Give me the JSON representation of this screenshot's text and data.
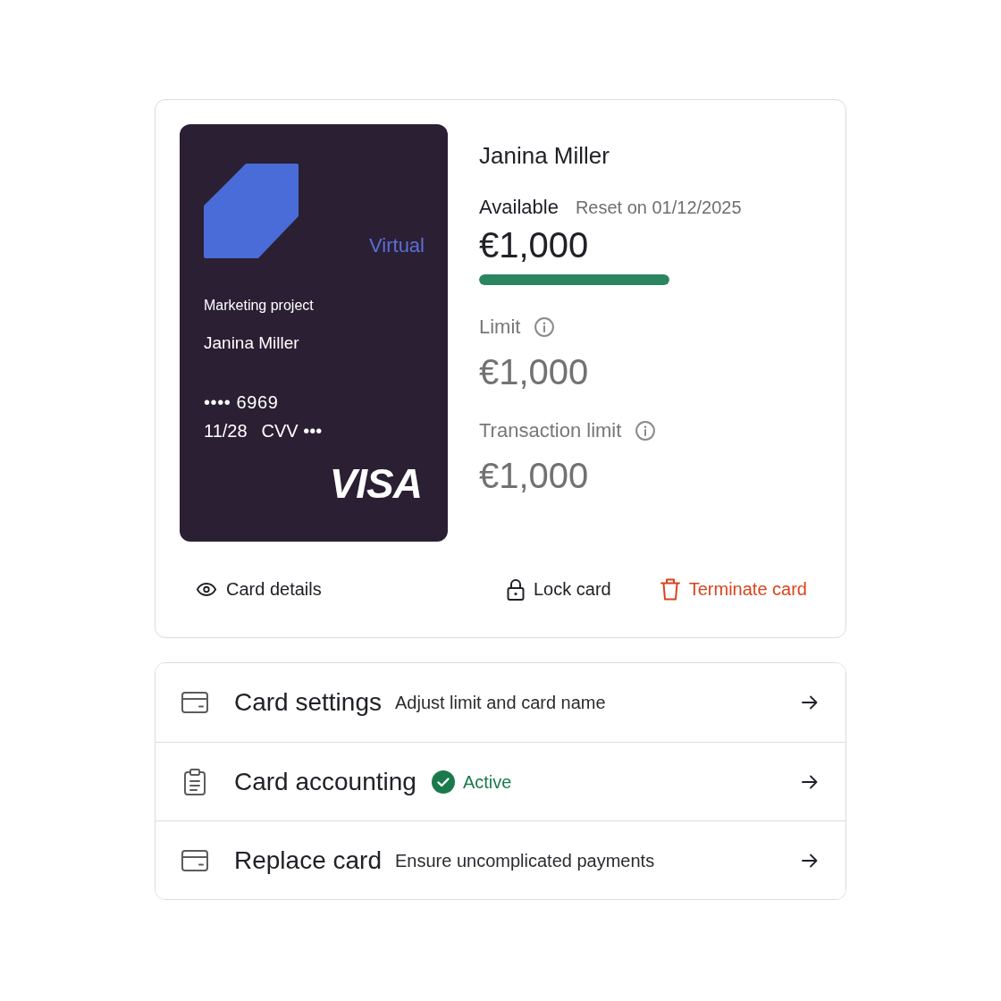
{
  "card": {
    "type": "Virtual",
    "project": "Marketing project",
    "holder": "Janina Miller",
    "number": "•••• 6969",
    "expiry": "11/28",
    "cvv": "CVV •••",
    "network": "VISA"
  },
  "summary": {
    "holder": "Janina Miller",
    "available": {
      "label": "Available",
      "reset": "Reset on 01/12/2025",
      "amount": "€1,000",
      "level": 1
    },
    "limits": [
      {
        "label": "Limit",
        "amount": "€1,000"
      },
      {
        "label": "Transaction limit",
        "amount": "€1,000"
      }
    ]
  },
  "actions": [
    {
      "kind": "view",
      "label": "Card details"
    },
    {
      "kind": "lock",
      "label": "Lock card"
    },
    {
      "kind": "terminate",
      "label": "Terminate card"
    }
  ],
  "menu": [
    {
      "kind": "card",
      "title": "Card settings",
      "subtitle": "Adjust limit and card name"
    },
    {
      "kind": "clipboard",
      "title": "Card accounting",
      "status": "Active"
    },
    {
      "kind": "card",
      "title": "Replace card",
      "subtitle": "Ensure uncomplicated payments"
    }
  ]
}
